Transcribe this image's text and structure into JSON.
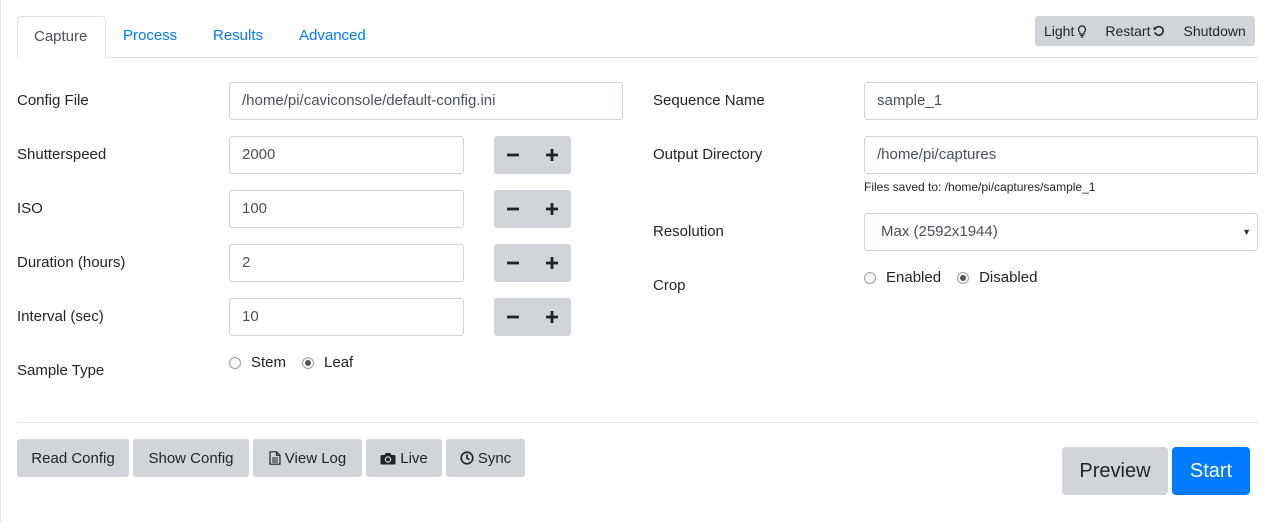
{
  "tabs": [
    {
      "label": "Capture"
    },
    {
      "label": "Process"
    },
    {
      "label": "Results"
    },
    {
      "label": "Advanced"
    }
  ],
  "system": {
    "light_label": "Light",
    "restart_label": "Restart",
    "shutdown_label": "Shutdown"
  },
  "capture": {
    "config_file": {
      "label": "Config File",
      "value": "/home/pi/caviconsole/default-config.ini"
    },
    "shutterspeed": {
      "label": "Shutterspeed",
      "value": "2000"
    },
    "iso": {
      "label": "ISO",
      "value": "100"
    },
    "duration": {
      "label": "Duration (hours)",
      "value": "2"
    },
    "interval": {
      "label": "Interval (sec)",
      "value": "10"
    },
    "sample_type": {
      "label": "Sample Type",
      "options": [
        "Stem",
        "Leaf"
      ],
      "selected": "Leaf"
    },
    "sequence_name": {
      "label": "Sequence Name",
      "value": "sample_1"
    },
    "output_directory": {
      "label": "Output Directory",
      "value": "/home/pi/captures",
      "help": "Files saved to: /home/pi/captures/sample_1"
    },
    "resolution": {
      "label": "Resolution",
      "value": "Max (2592x1944)"
    },
    "crop": {
      "label": "Crop",
      "options": [
        "Enabled",
        "Disabled"
      ],
      "selected": "Disabled"
    }
  },
  "actions": {
    "read_config": "Read Config",
    "show_config": "Show Config",
    "view_log": "View Log",
    "live": "Live",
    "sync": "Sync",
    "preview": "Preview",
    "start": "Start"
  },
  "colors": {
    "accent": "#007bff",
    "button_bg": "#d1d4d8"
  }
}
